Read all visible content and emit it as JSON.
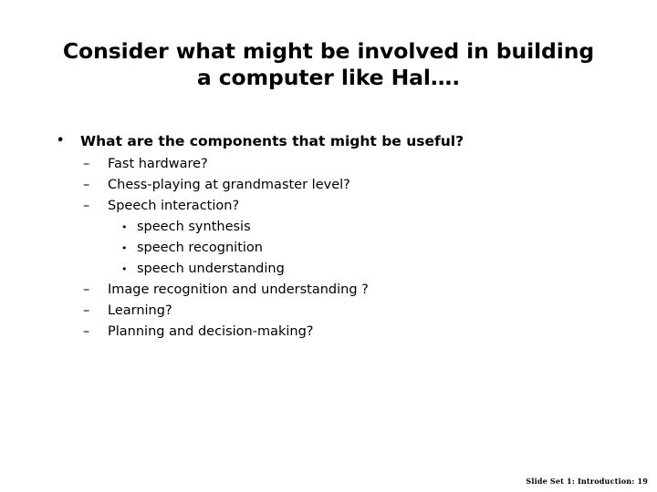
{
  "slide": {
    "background_color": "#ffffff",
    "text_color": "#000000",
    "title": {
      "line1": "Consider what might be involved in building",
      "line2": "a computer like Hal…."
    },
    "bullets": [
      {
        "level": 1,
        "marker": "•",
        "marker_name": "bullet-disc",
        "text": "What are the components that might be useful?"
      },
      {
        "level": 2,
        "marker": "–",
        "marker_name": "bullet-dash",
        "text": "Fast hardware?"
      },
      {
        "level": 2,
        "marker": "–",
        "marker_name": "bullet-dash",
        "text": "Chess-playing at grandmaster level?"
      },
      {
        "level": 2,
        "marker": "–",
        "marker_name": "bullet-dash",
        "text": "Speech interaction?"
      },
      {
        "level": 3,
        "marker": "•",
        "marker_name": "bullet-disc",
        "text": "speech synthesis"
      },
      {
        "level": 3,
        "marker": "•",
        "marker_name": "bullet-disc",
        "text": "speech recognition"
      },
      {
        "level": 3,
        "marker": "•",
        "marker_name": "bullet-disc",
        "text": "speech understanding"
      },
      {
        "level": 2,
        "marker": "–",
        "marker_name": "bullet-dash",
        "text": "Image recognition and understanding ?"
      },
      {
        "level": 2,
        "marker": "–",
        "marker_name": "bullet-dash",
        "text": "Learning?"
      },
      {
        "level": 2,
        "marker": "–",
        "marker_name": "bullet-dash",
        "text": "Planning and decision-making?"
      }
    ],
    "footer": {
      "text": "Slide Set 1: Introduction: 19"
    }
  }
}
